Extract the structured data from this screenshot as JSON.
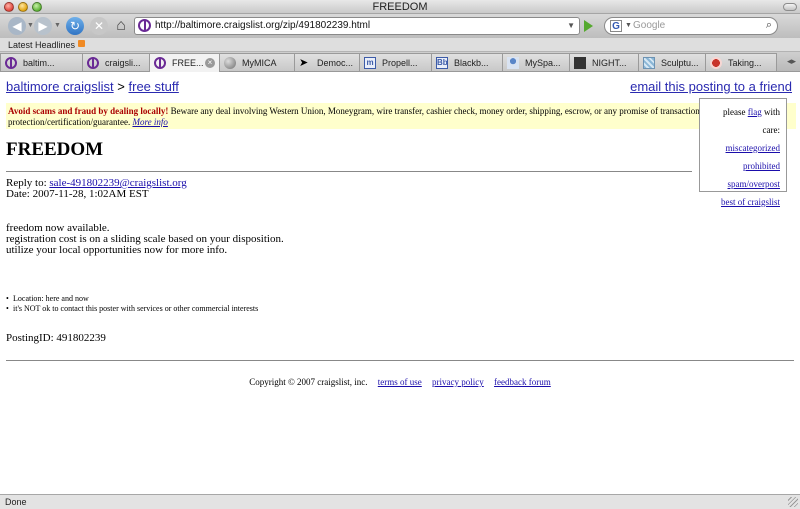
{
  "window": {
    "title": "FREEDOM"
  },
  "toolbar": {
    "url": "http://baltimore.craigslist.org/zip/491802239.html",
    "search_engine": "G",
    "search_placeholder": "Google"
  },
  "bookmarks": {
    "latest_headlines": "Latest Headlines"
  },
  "tabs": [
    {
      "label": "baltim...",
      "icon": "peace-icon",
      "active": false
    },
    {
      "label": "craigsli...",
      "icon": "peace-icon",
      "active": false
    },
    {
      "label": "FREE...",
      "icon": "peace-icon",
      "active": true
    },
    {
      "label": "MyMICA",
      "icon": "globe-icon",
      "active": false
    },
    {
      "label": "Democ...",
      "icon": "cursor-icon",
      "active": false
    },
    {
      "label": "Propell...",
      "icon": "box-icon",
      "active": false
    },
    {
      "label": "Blackb...",
      "icon": "box-icon",
      "active": false
    },
    {
      "label": "MySpa...",
      "icon": "people-icon",
      "active": false
    },
    {
      "label": "NIGHT...",
      "icon": "dark-icon",
      "active": false
    },
    {
      "label": "Sculptu...",
      "icon": "grid-icon",
      "active": false
    },
    {
      "label": "Taking...",
      "icon": "red-icon",
      "active": false
    }
  ],
  "page": {
    "crumb_site": "baltimore craigslist",
    "crumb_sep": ">",
    "crumb_section": "free stuff",
    "email_friend": "email this posting to a friend",
    "warning_strong": "Avoid scams and fraud by dealing locally!",
    "warning_text": " Beware any deal involving Western Union, Moneygram, wire transfer, cashier check, money order, shipping, escrow, or any promise of transaction protection/certification/guarantee. ",
    "warning_more": "More info",
    "flag_prefix": "please ",
    "flag_link": "flag",
    "flag_suffix": " with care:",
    "flag_options": [
      "miscategorized",
      "prohibited",
      "spam/overpost",
      "best of craigslist"
    ],
    "title": "FREEDOM",
    "reply_label": "Reply to: ",
    "reply_email": "sale-491802239@craigslist.org",
    "date": "Date: 2007-11-28, 1:02AM EST",
    "body_lines": [
      "freedom now available.",
      "registration cost is on a sliding scale based on your disposition.",
      "utilize your local opportunities now for more info."
    ],
    "bullets": [
      "Location: here and now",
      "it's NOT ok to contact this poster with services or other commercial interests"
    ],
    "posting_id": "PostingID: 491802239",
    "copyright": "Copyright © 2007 craigslist, inc.",
    "footer_links": [
      "terms of use",
      "privacy policy",
      "feedback forum"
    ]
  },
  "status": {
    "text": "Done"
  }
}
